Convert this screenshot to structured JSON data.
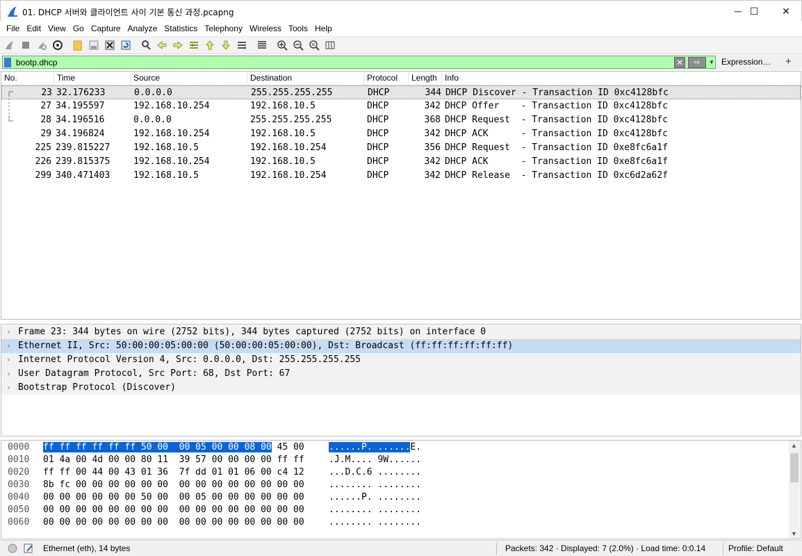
{
  "window": {
    "title": "01. DHCP 서버와 클라이언트 사이 기본 통신 과정.pcapng",
    "controls": {
      "minimize": "─",
      "maximize": "☐",
      "close": "✕"
    }
  },
  "menu": [
    {
      "label": "File"
    },
    {
      "label": "Edit"
    },
    {
      "label": "View"
    },
    {
      "label": "Go"
    },
    {
      "label": "Capture"
    },
    {
      "label": "Analyze"
    },
    {
      "label": "Statistics"
    },
    {
      "label": "Telephony"
    },
    {
      "label": "Wireless"
    },
    {
      "label": "Tools"
    },
    {
      "label": "Help"
    }
  ],
  "filter": {
    "value": "bootp.dhcp",
    "clear_glyph": "✕",
    "apply_glyph": "⇨",
    "dropdown_glyph": "▼",
    "expression_label": "Expression…",
    "add_glyph": "+"
  },
  "packet_list": {
    "columns": {
      "no": "No.",
      "time": "Time",
      "source": "Source",
      "destination": "Destination",
      "protocol": "Protocol",
      "length": "Length",
      "info": "Info"
    },
    "rows": [
      {
        "no": "23",
        "time": "32.176233",
        "source": "0.0.0.0",
        "destination": "255.255.255.255",
        "protocol": "DHCP",
        "length": "344",
        "info": "DHCP Discover - Transaction ID 0xc4128bfc"
      },
      {
        "no": "27",
        "time": "34.195597",
        "source": "192.168.10.254",
        "destination": "192.168.10.5",
        "protocol": "DHCP",
        "length": "342",
        "info": "DHCP Offer    - Transaction ID 0xc4128bfc"
      },
      {
        "no": "28",
        "time": "34.196516",
        "source": "0.0.0.0",
        "destination": "255.255.255.255",
        "protocol": "DHCP",
        "length": "368",
        "info": "DHCP Request  - Transaction ID 0xc4128bfc"
      },
      {
        "no": "29",
        "time": "34.196824",
        "source": "192.168.10.254",
        "destination": "192.168.10.5",
        "protocol": "DHCP",
        "length": "342",
        "info": "DHCP ACK      - Transaction ID 0xc4128bfc"
      },
      {
        "no": "225",
        "time": "239.815227",
        "source": "192.168.10.5",
        "destination": "192.168.10.254",
        "protocol": "DHCP",
        "length": "356",
        "info": "DHCP Request  - Transaction ID 0xe8fc6a1f"
      },
      {
        "no": "226",
        "time": "239.815375",
        "source": "192.168.10.254",
        "destination": "192.168.10.5",
        "protocol": "DHCP",
        "length": "342",
        "info": "DHCP ACK      - Transaction ID 0xe8fc6a1f"
      },
      {
        "no": "299",
        "time": "340.471403",
        "source": "192.168.10.5",
        "destination": "192.168.10.254",
        "protocol": "DHCP",
        "length": "342",
        "info": "DHCP Release  - Transaction ID 0xc6d2a62f"
      }
    ]
  },
  "details": {
    "rows": [
      {
        "arrow": "›",
        "text": "Frame 23: 344 bytes on wire (2752 bits), 344 bytes captured (2752 bits) on interface 0"
      },
      {
        "arrow": "›",
        "text": "Ethernet II, Src: 50:00:00:05:00:00 (50:00:00:05:00:00), Dst: Broadcast (ff:ff:ff:ff:ff:ff)"
      },
      {
        "arrow": "›",
        "text": "Internet Protocol Version 4, Src: 0.0.0.0, Dst: 255.255.255.255"
      },
      {
        "arrow": "›",
        "text": "User Datagram Protocol, Src Port: 68, Dst Port: 67"
      },
      {
        "arrow": "›",
        "text": "Bootstrap Protocol (Discover)"
      }
    ]
  },
  "bytes": {
    "rows": [
      {
        "offset": "0000",
        "hex_hl": "ff ff ff ff ff ff 50 00  00 05 00 00 08 00",
        "hex_rest": " 45 00",
        "ascii_hl": "......P. ......",
        "ascii_rest": "E."
      },
      {
        "offset": "0010",
        "hex_hl": "",
        "hex_rest": "01 4a 00 4d 00 00 80 11  39 57 00 00 00 00 ff ff",
        "ascii_hl": "",
        "ascii_rest": ".J.M.... 9W......"
      },
      {
        "offset": "0020",
        "hex_hl": "",
        "hex_rest": "ff ff 00 44 00 43 01 36  7f dd 01 01 06 00 c4 12",
        "ascii_hl": "",
        "ascii_rest": "...D.C.6 ........"
      },
      {
        "offset": "0030",
        "hex_hl": "",
        "hex_rest": "8b fc 00 00 00 00 00 00  00 00 00 00 00 00 00 00",
        "ascii_hl": "",
        "ascii_rest": "........ ........"
      },
      {
        "offset": "0040",
        "hex_hl": "",
        "hex_rest": "00 00 00 00 00 00 50 00  00 05 00 00 00 00 00 00",
        "ascii_hl": "",
        "ascii_rest": "......P. ........"
      },
      {
        "offset": "0050",
        "hex_hl": "",
        "hex_rest": "00 00 00 00 00 00 00 00  00 00 00 00 00 00 00 00",
        "ascii_hl": "",
        "ascii_rest": "........ ........"
      },
      {
        "offset": "0060",
        "hex_hl": "",
        "hex_rest": "00 00 00 00 00 00 00 00  00 00 00 00 00 00 00 00",
        "ascii_hl": "",
        "ascii_rest": "........ ........"
      }
    ]
  },
  "statusbar": {
    "field_info": "Ethernet (eth), 14 bytes",
    "packets": "Packets: 342 · Displayed: 7 (2.0%) · Load time: 0:0.14",
    "profile": "Profile: Default"
  },
  "colors": {
    "filter_valid_bg": "#afffaf",
    "selected_row_bg": "#e5e5e5",
    "detail_highlight_bg": "#c6dcf0",
    "byte_highlight_bg": "#0a64d8"
  }
}
